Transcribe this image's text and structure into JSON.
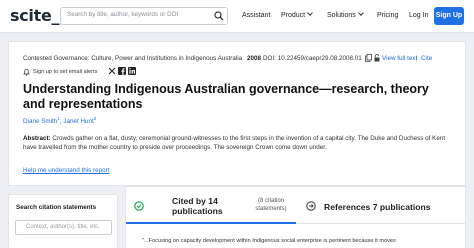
{
  "header": {
    "logo": "scite_",
    "search_placeholder": "Search by title, author, keywords or DOI",
    "nav": {
      "assistant": "Assistant",
      "product": "Product",
      "solutions": "Solutions",
      "pricing": "Pricing",
      "login": "Log In",
      "signup": "Sign Up"
    }
  },
  "paper": {
    "journal": "Contested Governance: Culture, Power and Institutions in Indigenous Australia",
    "year": "2008",
    "doi": "DOI: 10.22459/caepr29.08.2008.01",
    "view_full_text": "View full text",
    "separator": "|",
    "cite": "Cite",
    "alert_text": "Sign up to set email alerts",
    "title": "Understanding Indigenous Australian governance—research, theory and representations",
    "authors": [
      {
        "name": "Diane Smith",
        "sup": "1"
      },
      {
        "name": "Janet Hunt",
        "sup": "2"
      }
    ],
    "abstract_label": "Abstract:",
    "abstract_text": "Crowds gather on a flat, dusty, ceremonial ground-witnesses to the first steps in the invention of a capital city. The Duke and Duchess of Kent have travelled from the mother country to preside over proceedings. The sovereign Crown come down under.",
    "help_link": "Help me understand this report"
  },
  "citations": {
    "search_title": "Search citation statements",
    "search_placeholder": "Context, author(s), title, etc.",
    "cited_by_label": "Cited by 14 publications",
    "cited_count": "(8 citation statements)",
    "references_label": "References 7 publications",
    "snippet": "\"...Focusing on capacity development within Indigenous social enterprise is pertinent because it moves"
  },
  "colors": {
    "accent": "#1f6fe5",
    "background": "#eeeff2"
  }
}
